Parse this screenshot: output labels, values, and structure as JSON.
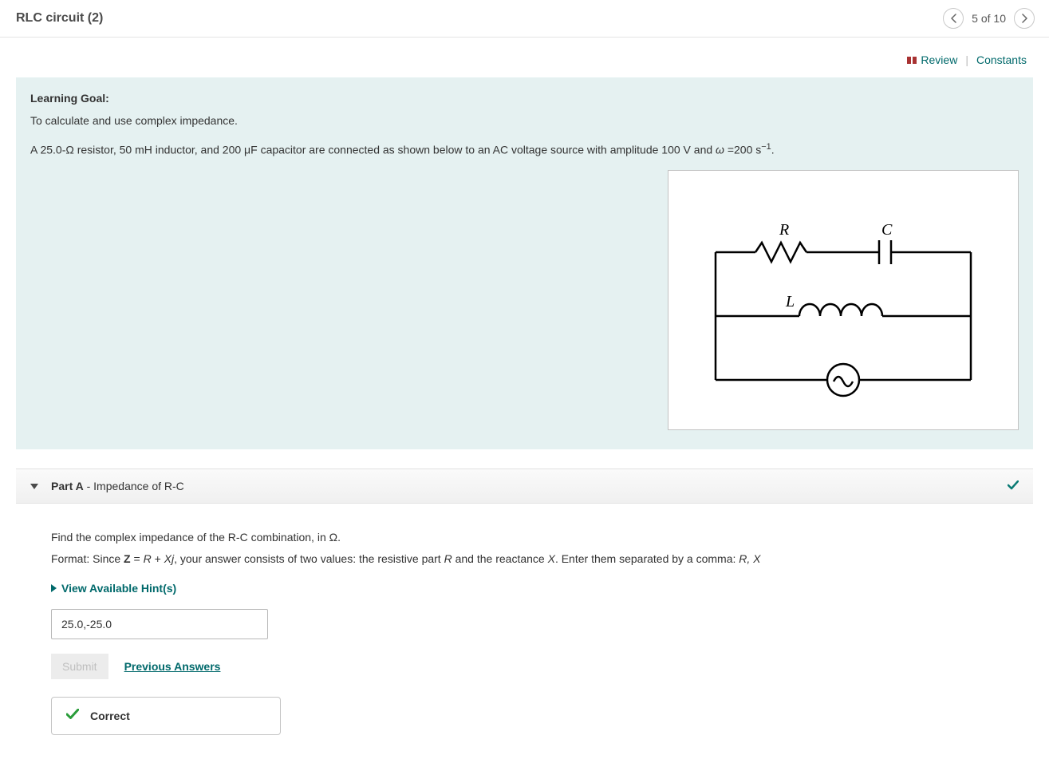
{
  "header": {
    "title": "RLC circuit (2)",
    "page_indicator": "5 of 10"
  },
  "links": {
    "review": "Review",
    "constants": "Constants"
  },
  "goal": {
    "heading": "Learning Goal:",
    "text": "To calculate and use complex impedance.",
    "problem_prefix": "A 25.0-Ω resistor, 50 mH inductor, and 200 μF capacitor are connected as shown below to an AC voltage source with amplitude 100 V and ",
    "omega": "ω",
    "problem_suffix_1": " =200 s",
    "exponent": "−1",
    "problem_suffix_2": "."
  },
  "circuit": {
    "R_label": "R",
    "C_label": "C",
    "L_label": "L"
  },
  "partA": {
    "label": "Part A",
    "dash": " - ",
    "subtitle": "Impedance of R-C",
    "instruction": "Find the complex impedance of the R-C combination, in Ω.",
    "format_prefix": "Format: Since ",
    "Z": "Z",
    "eq": " = ",
    "R": "R",
    "plus": " + ",
    "Xj": "Xj",
    "format_mid": ", your answer consists of two values: the resistive part ",
    "R2": "R",
    "and": " and the reactance ",
    "X": "X",
    "format_tail": ". Enter them separated by a comma: ",
    "RX": "R, X",
    "hints_label": "View Available Hint(s)",
    "answer_value": "25.0,-25.0",
    "submit_label": "Submit",
    "prev_answers": "Previous Answers",
    "correct_label": "Correct"
  }
}
